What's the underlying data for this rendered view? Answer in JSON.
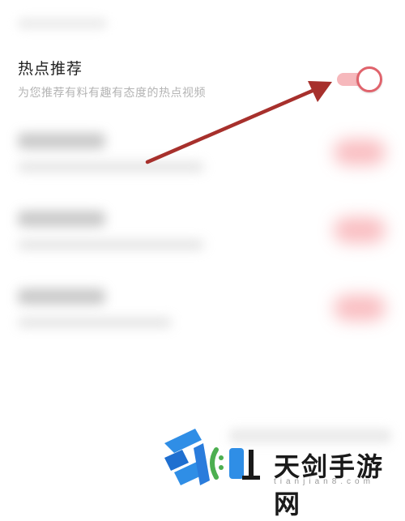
{
  "settings": {
    "hot_recommend": {
      "title": "热点推荐",
      "subtitle": "为您推荐有料有趣有态度的热点视频",
      "enabled": true
    }
  },
  "watermark": {
    "title": "天剑手游网",
    "subtitle": "tianjian8.com"
  },
  "colors": {
    "accent": "#e0636c",
    "track": "#f6b8bc",
    "arrow": "#a7302c",
    "title_text": "#1f1f1f",
    "subtitle_text": "#b4b4b4"
  }
}
